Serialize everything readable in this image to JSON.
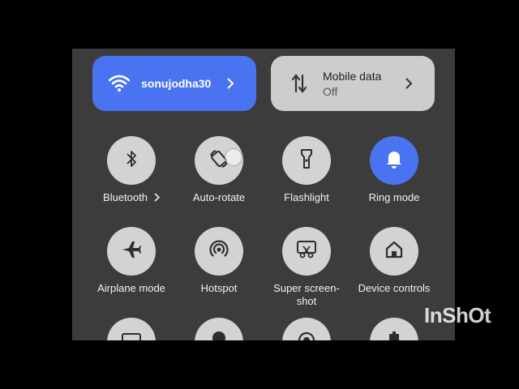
{
  "wifi": {
    "network_name": "sonujodha30",
    "icon": "wifi-icon",
    "color": "#4a73f1"
  },
  "mobile_data": {
    "title": "Mobile data",
    "status": "Off",
    "icon": "mobile-data-arrows-icon"
  },
  "tiles": [
    {
      "label": "Bluetooth",
      "icon": "bluetooth-icon",
      "active": false,
      "has_chevron": true
    },
    {
      "label": "Auto-rotate",
      "icon": "auto-rotate-icon",
      "active": false
    },
    {
      "label": "Flashlight",
      "icon": "flashlight-icon",
      "active": false
    },
    {
      "label": "Ring mode",
      "icon": "bell-icon",
      "active": true
    },
    {
      "label": "Airplane mode",
      "icon": "airplane-icon",
      "active": false
    },
    {
      "label": "Hotspot",
      "icon": "hotspot-icon",
      "active": false
    },
    {
      "label": "Super screen-shot",
      "line1": "Super screen-",
      "line2": "shot",
      "icon": "screenshot-scissors-icon",
      "active": false
    },
    {
      "label": "Device controls",
      "icon": "home-icon",
      "active": false
    }
  ],
  "watermark": "InShOt",
  "colors": {
    "accent": "#4a73f1",
    "tile": "#d3d3d3",
    "panel": "#3c3c3c"
  }
}
